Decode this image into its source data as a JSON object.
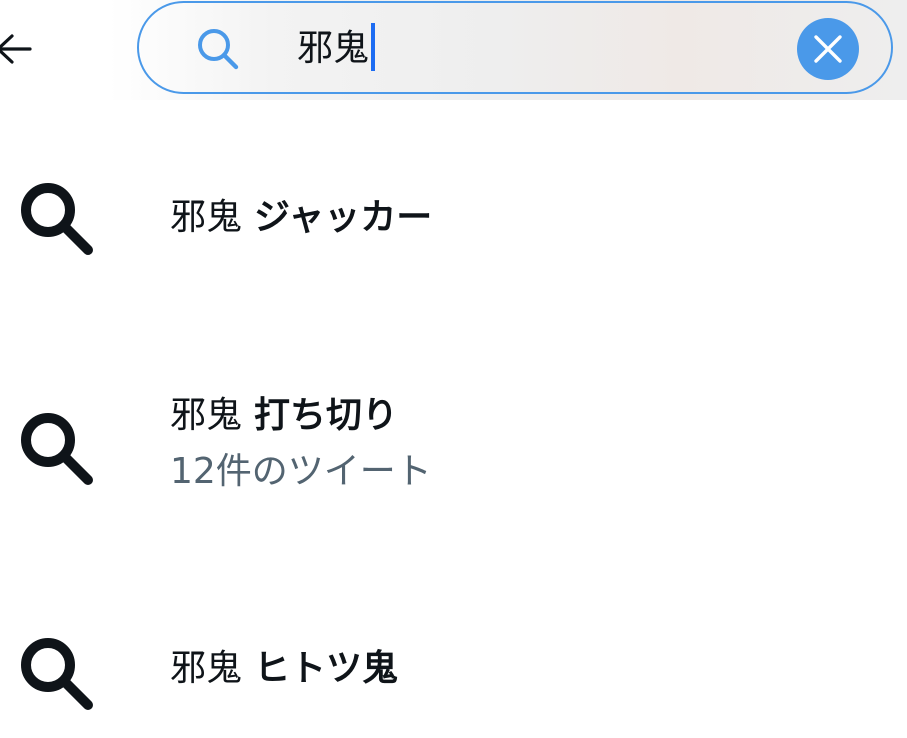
{
  "colors": {
    "accent": "#4a99e9",
    "caret": "#1d6cf2",
    "text_primary": "#0f1419",
    "text_secondary": "#536471"
  },
  "header": {
    "back_icon": "arrow-left-icon",
    "search": {
      "icon": "search-icon",
      "value": "邪鬼",
      "clear_icon": "close-icon"
    }
  },
  "suggestions": [
    {
      "prefix": "邪鬼",
      "bold": "ジャッカー",
      "sub": ""
    },
    {
      "prefix": "邪鬼",
      "bold": "打ち切り",
      "sub": "12件のツイート"
    },
    {
      "prefix": "邪鬼",
      "bold": "ヒトツ鬼",
      "sub": ""
    }
  ]
}
